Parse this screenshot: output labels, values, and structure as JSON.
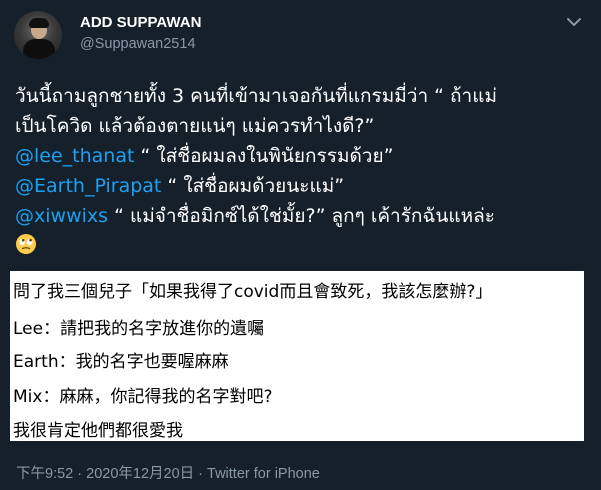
{
  "author": {
    "display_name": "ADD SUPPAWAN",
    "handle": "@Suppawan2514"
  },
  "tweet": {
    "lines": [
      {
        "pre": "วันนี้ถามลูกชายทั้ง 3 คนที่เข้ามาเจอกันที่แกรมมี่ว่า “ ถ้าแม่"
      },
      {
        "pre": "เป็นโควิด  แล้วต้องตายแน่ๆ แม่ควรทำไงดี?”"
      },
      {
        "mention": "@lee_thanat",
        "post": "  “ ใส่ชื่อผมลงในพินัยกรรมด้วย”"
      },
      {
        "mention": " @Earth_Pirapat",
        "post": "  “ ใส่ชื่อผมด้วยนะแม่”"
      },
      {
        "mention": "@xiwwixs",
        "post": "  “ แม่จำชื่อมิกซ์ได้ใช่มั้ย?”  ลูกๆ เค้ารักฉันแหล่ะ"
      }
    ],
    "emoji": "rolling-eyes-face"
  },
  "media": {
    "lines": [
      "問了我三個兒子「如果我得了covid而且會致死，我該怎麼辦?」",
      "Lee：請把我的名字放進你的遺囑",
      "Earth：我的名字也要喔麻麻",
      "Mix：麻麻，你記得我的名字對吧?",
      "我很肯定他們都很愛我"
    ]
  },
  "meta": {
    "time": "下午9:52",
    "sep": " · ",
    "date": "2020年12月20日",
    "source": "Twitter for iPhone"
  },
  "colors": {
    "background": "#15202b",
    "mention": "#1da1f2",
    "secondary_text": "#8899a6",
    "media_background": "#ffffff"
  }
}
